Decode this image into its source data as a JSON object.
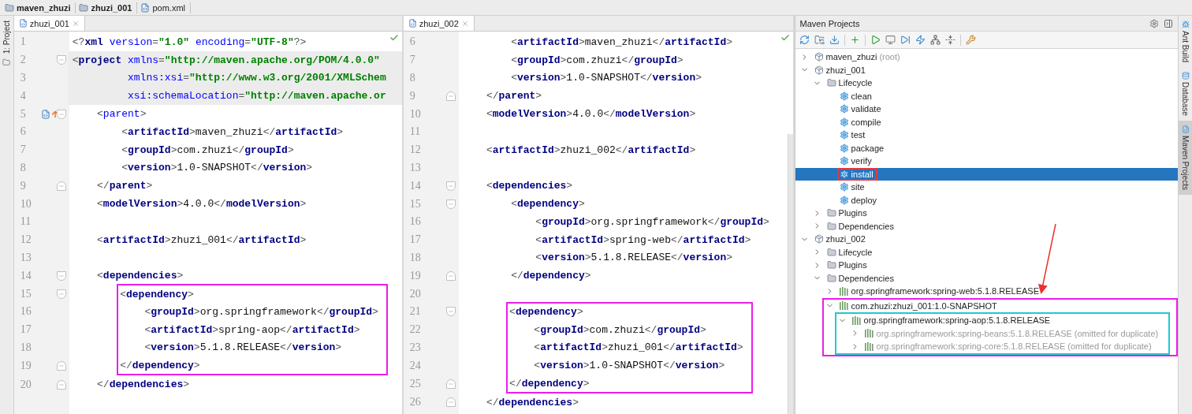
{
  "breadcrumb": [
    {
      "label": "maven_zhuzi",
      "kind": "folder"
    },
    {
      "label": "zhuzi_001",
      "kind": "folder"
    },
    {
      "label": "pom.xml",
      "kind": "maven"
    }
  ],
  "left_strip": {
    "label": "1: Project"
  },
  "editors": [
    {
      "tab": {
        "label": "zhuzi_001",
        "selected": true
      },
      "lines": [
        {
          "number": "1",
          "code": "<?xml version=\"1.0\" encoding=\"UTF-8\"?>"
        },
        {
          "number": "2",
          "code": "<project xmlns=\"http://maven.apache.org/POM/4.0.0\"",
          "fold_start": true,
          "highlighted": true
        },
        {
          "number": "3",
          "code": "         xmlns:xsi=\"http://www.w3.org/2001/XMLSchem",
          "highlighted": true
        },
        {
          "number": "4",
          "code": "         xsi:schemaLocation=\"http://maven.apache.or",
          "highlighted": true
        },
        {
          "number": "5",
          "code": "    <parent>",
          "fold_start": true,
          "overrides_parent": true
        },
        {
          "number": "6",
          "code": "        <artifactId>maven_zhuzi</artifactId>"
        },
        {
          "number": "7",
          "code": "        <groupId>com.zhuzi</groupId>"
        },
        {
          "number": "8",
          "code": "        <version>1.0-SNAPSHOT</version>"
        },
        {
          "number": "9",
          "code": "    </parent>",
          "fold_end": true
        },
        {
          "number": "10",
          "code": "    <modelVersion>4.0.0</modelVersion>"
        },
        {
          "number": "11"
        },
        {
          "number": "12",
          "code": "    <artifactId>zhuzi_001</artifactId>"
        },
        {
          "number": "13"
        },
        {
          "number": "14",
          "code": "    <dependencies>",
          "fold_start": true
        },
        {
          "number": "15",
          "code": "        <dependency>",
          "fold_start": true,
          "boxed": true
        },
        {
          "number": "16",
          "code": "            <groupId>org.springframework</groupId>",
          "boxed": true
        },
        {
          "number": "17",
          "code": "            <artifactId>spring-aop</artifactId>",
          "boxed": true
        },
        {
          "number": "18",
          "code": "            <version>5.1.8.RELEASE</version>",
          "boxed": true
        },
        {
          "number": "19",
          "code": "        </dependency>",
          "fold_end": true,
          "boxed": true
        },
        {
          "number": "20",
          "code": "    </dependencies>",
          "fold_end": true
        }
      ]
    },
    {
      "tab": {
        "label": "zhuzi_002",
        "selected": true
      },
      "lines": [
        {
          "number": "6",
          "code": "        <artifactId>maven_zhuzi</artifactId>"
        },
        {
          "number": "7",
          "code": "        <groupId>com.zhuzi</groupId>"
        },
        {
          "number": "8",
          "code": "        <version>1.0-SNAPSHOT</version>"
        },
        {
          "number": "9",
          "code": "    </parent>",
          "fold_end": true
        },
        {
          "number": "10",
          "code": "    <modelVersion>4.0.0</modelVersion>"
        },
        {
          "number": "11"
        },
        {
          "number": "12",
          "code": "    <artifactId>zhuzi_002</artifactId>"
        },
        {
          "number": "13"
        },
        {
          "number": "14",
          "code": "    <dependencies>",
          "fold_start": true
        },
        {
          "number": "15",
          "code": "        <dependency>",
          "fold_start": true
        },
        {
          "number": "16",
          "code": "            <groupId>org.springframework</groupId>"
        },
        {
          "number": "17",
          "code": "            <artifactId>spring-web</artifactId>"
        },
        {
          "number": "18",
          "code": "            <version>5.1.8.RELEASE</version>"
        },
        {
          "number": "19",
          "code": "        </dependency>",
          "fold_end": true
        },
        {
          "number": "20"
        },
        {
          "number": "21",
          "code": "        <dependency>",
          "fold_start": true,
          "boxed": true
        },
        {
          "number": "22",
          "code": "            <groupId>com.zhuzi</groupId>",
          "boxed": true
        },
        {
          "number": "23",
          "code": "            <artifactId>zhuzi_001</artifactId>",
          "boxed": true
        },
        {
          "number": "24",
          "code": "            <version>1.0-SNAPSHOT</version>",
          "boxed": true
        },
        {
          "number": "25",
          "code": "        </dependency>",
          "fold_end": true,
          "boxed": true
        },
        {
          "number": "26",
          "code": "    </dependencies>",
          "fold_end": true
        }
      ]
    }
  ],
  "maven_panel": {
    "title": "Maven Projects",
    "tree": [
      {
        "label": "maven_zhuzi",
        "note": "(root)",
        "kind": "module",
        "expanded": false,
        "selected": false
      },
      {
        "label": "zhuzi_001",
        "kind": "module",
        "expanded": true,
        "selected": false,
        "children": [
          {
            "label": "Lifecycle",
            "kind": "folder",
            "expanded": true,
            "selected": false,
            "children": [
              {
                "label": "clean",
                "kind": "goal",
                "selected": false
              },
              {
                "label": "validate",
                "kind": "goal",
                "selected": false
              },
              {
                "label": "compile",
                "kind": "goal",
                "selected": false
              },
              {
                "label": "test",
                "kind": "goal",
                "selected": false
              },
              {
                "label": "package",
                "kind": "goal",
                "selected": false
              },
              {
                "label": "verify",
                "kind": "goal",
                "selected": false
              },
              {
                "label": "install",
                "kind": "goal",
                "selected": true,
                "color": "#e23b3b"
              },
              {
                "label": "site",
                "kind": "goal",
                "selected": false
              },
              {
                "label": "deploy",
                "kind": "goal",
                "selected": false
              }
            ]
          },
          {
            "label": "Plugins",
            "kind": "folder",
            "expanded": false,
            "selected": false
          },
          {
            "label": "Dependencies",
            "kind": "folder",
            "expanded": false,
            "selected": false
          }
        ]
      },
      {
        "label": "zhuzi_002",
        "kind": "module",
        "expanded": true,
        "selected": false,
        "children": [
          {
            "label": "Lifecycle",
            "kind": "folder",
            "expanded": false,
            "selected": false
          },
          {
            "label": "Plugins",
            "kind": "folder",
            "expanded": false,
            "selected": false
          },
          {
            "label": "Dependencies",
            "kind": "folder",
            "expanded": true,
            "selected": false,
            "children": [
              {
                "label": "org.springframework:spring-web:5.1.8.RELEASE",
                "kind": "library",
                "expanded": false,
                "selected": false
              },
              {
                "label": "com.zhuzi:zhuzi_001:1.0-SNAPSHOT",
                "kind": "library",
                "expanded": true,
                "selected": false,
                "color": "#e91ee9",
                "children": [
                  {
                    "label": "org.springframework:spring-aop:5.1.8.RELEASE",
                    "kind": "library",
                    "expanded": true,
                    "selected": false,
                    "color": "#21c9cf",
                    "children": [
                      {
                        "label": "org.springframework:spring-beans:5.1.8.RELEASE",
                        "note": "(omitted for duplicate)",
                        "kind": "library",
                        "expanded": false,
                        "selected": false,
                        "dimmed": true
                      },
                      {
                        "label": "org.springframework:spring-core:5.1.8.RELEASE",
                        "note": "(omitted for duplicate)",
                        "kind": "library",
                        "expanded": false,
                        "selected": false,
                        "dimmed": true
                      }
                    ]
                  }
                ]
              }
            ]
          }
        ]
      }
    ]
  },
  "right_strip": [
    {
      "label": "Ant Build",
      "selected": false
    },
    {
      "label": "Database",
      "selected": false
    },
    {
      "label": "Maven Projects",
      "selected": true
    }
  ]
}
